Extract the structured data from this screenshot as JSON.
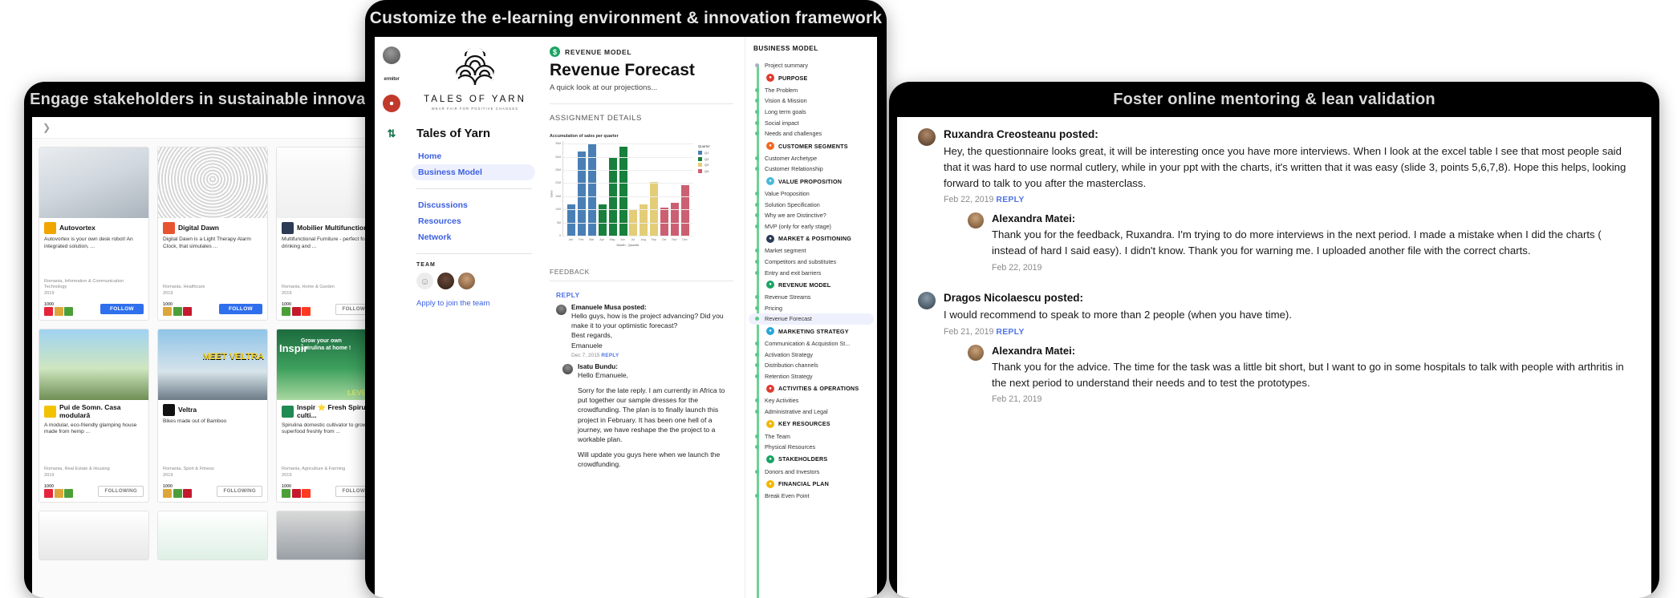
{
  "panels": {
    "left_title": "Engage stakeholders in sustainable innovation",
    "center_title": "Customize the e-learning environment & innovation framework",
    "right_title": "Foster online mentoring & lean validation"
  },
  "left_panel": {
    "projects": [
      {
        "name": "Autovortex",
        "desc": "Autovortex is your own desk robot! An integrated solution, ...",
        "meta": "Romania, Information & Communication Technology",
        "year": "2019",
        "score": "1000",
        "action": "FOLLOW",
        "icon_color": "#f0a500"
      },
      {
        "name": "Digital Dawn",
        "desc": "Digital Dawn is a Light Therapy Alarm Clock, that simulates ...",
        "meta": "Romania, Healthcare",
        "year": "2019",
        "score": "1000",
        "action": "FOLLOW",
        "icon_color": "#e8542f"
      },
      {
        "name": "Mobilier Multifunctional",
        "desc": "Multifunctional Furniture - perfect for drinking and ...",
        "meta": "Romania, Home & Garden",
        "year": "2019",
        "score": "1000",
        "action": "FOLLOWING",
        "icon_color": "#2b3a55"
      },
      {
        "name": "Pui de Somn. Casa modulară",
        "desc": "A modular, eco-friendly glamping house made from hemp ...",
        "meta": "Romania, Real Estate & Housing",
        "year": "2019",
        "score": "1000",
        "action": "FOLLOWING",
        "icon_color": "#f2c200"
      },
      {
        "name": "Veltra",
        "desc": "Bikes made out of Bamboo",
        "meta": "Romania, Sport & Fitness",
        "year": "2019",
        "score": "1000",
        "action": "FOLLOWING",
        "icon_color": "#111111"
      },
      {
        "name": "Inspir ⭐ Fresh Spirulina culti...",
        "desc": "Spirulina domestic cultivator to grow superfood freshly from ...",
        "meta": "Romania, Agriculture & Farming",
        "year": "2019",
        "score": "1000",
        "action": "FOLLOWING",
        "icon_color": "#1f8a52"
      }
    ],
    "banner_texts": [
      "MEET VELTRA",
      "Grow your own spirulina at home !",
      "LEVEL UP"
    ]
  },
  "center_panel": {
    "rail": {
      "avatar": "user-avatar",
      "wordmark": "ermitor",
      "badges": [
        "sdg-red-badge",
        "sdg-green-badge"
      ]
    },
    "brand": {
      "name": "TALES OF YARN",
      "tagline": "WEAR FAIR FOR POSITIVE CHANGES"
    },
    "project_title": "Tales of Yarn",
    "nav": [
      {
        "label": "Home",
        "active": false
      },
      {
        "label": "Business Model",
        "active": true
      }
    ],
    "nav2": [
      {
        "label": "Discussions"
      },
      {
        "label": "Resources"
      },
      {
        "label": "Network"
      }
    ],
    "team_label": "TEAM",
    "team_members": [
      "member-placeholder",
      "member-2",
      "member-3"
    ],
    "apply_link": "Apply to join the team",
    "doc": {
      "kicker": "REVENUE MODEL",
      "kicker_icon": "dollar-circle-icon",
      "title": "Revenue Forecast",
      "subtitle": "A quick look at our projections...",
      "section_label": "ASSIGNMENT DETAILS",
      "feedback_label": "FEEDBACK",
      "reply_label": "REPLY"
    },
    "comments": [
      {
        "author": "Emanuele Musa posted:",
        "body": "Hello guys, how is the project advancing? Did you make it to your optimistic forecast?\nBest regards,\nEmanuele",
        "date": "Dec 7, 2015",
        "reply": "REPLY",
        "nested": false
      },
      {
        "author": "Isatu Bundu:",
        "body": "Hello Emanuele,\n\nSorry for the late reply. I am currently in Africa to put together our sample dresses for the crowdfunding. The plan is to finally launch this project in February. It has been one hell of a journey, we have reshape the the project to a workable plan.\n\nWill update you guys here when we launch the crowdfunding.",
        "date": "",
        "reply": "",
        "nested": true
      }
    ],
    "business_model": {
      "heading": "BUSINESS MODEL",
      "items": [
        {
          "type": "item",
          "label": "Project summary",
          "bullet": "grey"
        },
        {
          "type": "group",
          "label": "PURPOSE",
          "icon": "target-icon",
          "color": "#e03c31"
        },
        {
          "type": "item",
          "label": "The Problem"
        },
        {
          "type": "item",
          "label": "Vision & Mission"
        },
        {
          "type": "item",
          "label": "Long term goals"
        },
        {
          "type": "item",
          "label": "Social impact"
        },
        {
          "type": "item",
          "label": "Needs and challenges"
        },
        {
          "type": "group",
          "label": "CUSTOMER SEGMENTS",
          "icon": "people-icon",
          "color": "#f26722"
        },
        {
          "type": "item",
          "label": "Customer Archetype"
        },
        {
          "type": "item",
          "label": "Customer Relationship"
        },
        {
          "type": "group",
          "label": "VALUE PROPOSITION",
          "icon": "gift-icon",
          "color": "#4ab9d8"
        },
        {
          "type": "item",
          "label": "Value Proposition"
        },
        {
          "type": "item",
          "label": "Solution Specification"
        },
        {
          "type": "item",
          "label": "Why we are Distinctive?"
        },
        {
          "type": "item",
          "label": "MVP (only for early stage)"
        },
        {
          "type": "group",
          "label": "MARKET & POSITIONING",
          "icon": "pie-icon",
          "color": "#2b3a55"
        },
        {
          "type": "item",
          "label": "Market segment"
        },
        {
          "type": "item",
          "label": "Competitors and substitutes"
        },
        {
          "type": "item",
          "label": "Entry and exit barriers"
        },
        {
          "type": "group",
          "label": "REVENUE MODEL",
          "icon": "dollar-icon",
          "color": "#19a463"
        },
        {
          "type": "item",
          "label": "Revenue Streams"
        },
        {
          "type": "item",
          "label": "Pricing"
        },
        {
          "type": "item",
          "label": "Revenue Forecast",
          "selected": true
        },
        {
          "type": "group",
          "label": "MARKETING STRATEGY",
          "icon": "megaphone-icon",
          "color": "#26a8d8"
        },
        {
          "type": "item",
          "label": "Communication & Acquistion St..."
        },
        {
          "type": "item",
          "label": "Activation Strategy"
        },
        {
          "type": "item",
          "label": "Distribution channels"
        },
        {
          "type": "item",
          "label": "Retention Strategy"
        },
        {
          "type": "group",
          "label": "ACTIVITIES & OPERATIONS",
          "icon": "gear-icon",
          "color": "#e03c31"
        },
        {
          "type": "item",
          "label": "Key Activities"
        },
        {
          "type": "item",
          "label": "Administrative and Legal"
        },
        {
          "type": "group",
          "label": "KEY RESOURCES",
          "icon": "box-icon",
          "color": "#f2b705"
        },
        {
          "type": "item",
          "label": "The Team"
        },
        {
          "type": "item",
          "label": "Physical Resources"
        },
        {
          "type": "group",
          "label": "STAKEHOLDERS",
          "icon": "handshake-icon",
          "color": "#19a463"
        },
        {
          "type": "item",
          "label": "Donors and Investors"
        },
        {
          "type": "group",
          "label": "FINANCIAL PLAN",
          "icon": "coin-icon",
          "color": "#f2b705"
        },
        {
          "type": "item",
          "label": "Break Even Point"
        }
      ]
    }
  },
  "chart_data": {
    "type": "bar",
    "title": "Accumulation of sales per quarter",
    "xlabel": "Month , Quarter",
    "ylabel": "Sales",
    "categories": [
      "Jan",
      "Feb",
      "Mar",
      "Apr",
      "May",
      "Jun",
      "Jul",
      "Aug",
      "Sep",
      "Oct",
      "Nov",
      "Dec"
    ],
    "values": [
      12000,
      32000,
      35000,
      12000,
      30000,
      34000,
      10000,
      12000,
      20500,
      10800,
      12400,
      19300
    ],
    "bar_colors": [
      "#4a7fb5",
      "#4a7fb5",
      "#4a7fb5",
      "#18803c",
      "#18803c",
      "#18803c",
      "#e3cd77",
      "#e3cd77",
      "#e3cd77",
      "#cc5f72",
      "#cc5f72",
      "#cc5f72"
    ],
    "yticks": [
      0,
      5000,
      10000,
      15000,
      20000,
      25000,
      30000,
      35000
    ],
    "ytick_labels": [
      "0",
      "5M",
      "10M",
      "15M",
      "20M",
      "25M",
      "30M",
      "35M"
    ],
    "ylim": [
      0,
      36000
    ],
    "grid": true,
    "legend_title": "Quarter",
    "legend": [
      {
        "label": "Q1",
        "color": "#4a7fb5"
      },
      {
        "label": "Q2",
        "color": "#18803c"
      },
      {
        "label": "Q3",
        "color": "#e3cd77"
      },
      {
        "label": "Q4",
        "color": "#cc5f72"
      }
    ],
    "legend_position": "right"
  },
  "right_panel": {
    "threads": [
      {
        "author": "Ruxandra Creosteanu posted:",
        "body": "Hey, the questionnaire looks great, it will be interesting once you have more interviews. When I look at the excel table I see that most people said that it was hard to use normal cutlery, while in your ppt with the charts, it's written that it was easy (slide 3, points 5,6,7,8). Hope this helps, looking forward to talk to you after the masterclass.",
        "date": "Feb 22, 2019",
        "reply": "REPLY",
        "replies": [
          {
            "author": "Alexandra Matei:",
            "body": "Thank you for the feedback, Ruxandra. I'm trying to do more interviews in the next period. I made a mistake when I did the charts ( instead of hard I said easy).  I didn't know. Thank you for warning me. I uploaded another file with the correct charts.",
            "date": "Feb 22, 2019"
          }
        ]
      },
      {
        "author": "Dragos Nicolaescu posted:",
        "body": "I would recommend to speak to more than 2 people (when you have time).",
        "date": "Feb 21, 2019",
        "reply": "REPLY",
        "replies": [
          {
            "author": "Alexandra Matei:",
            "body": "Thank you for the advice. The time for the task was a little bit short, but I want to go in some hospitals to talk with people with arthritis in the next period to understand their needs and to test the prototypes.",
            "date": "Feb 21, 2019"
          }
        ]
      }
    ]
  }
}
